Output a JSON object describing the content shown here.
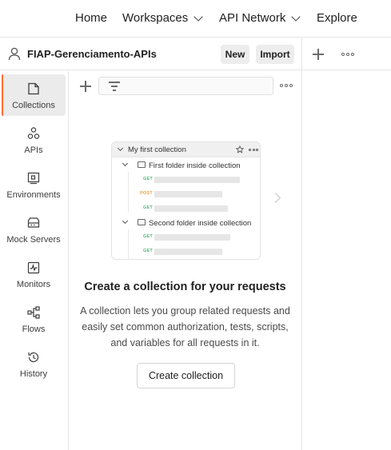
{
  "topnav": {
    "home": "Home",
    "workspaces": "Workspaces",
    "api_network": "API Network",
    "explore": "Explore"
  },
  "workspace": {
    "name": "FIAP-Gerenciamento-APIs",
    "new_label": "New",
    "import_label": "Import"
  },
  "sidebar": {
    "items": [
      {
        "label": "Collections",
        "icon": "collections-icon",
        "active": true
      },
      {
        "label": "APIs",
        "icon": "apis-icon"
      },
      {
        "label": "Environments",
        "icon": "environments-icon"
      },
      {
        "label": "Mock Servers",
        "icon": "mock-servers-icon"
      },
      {
        "label": "Monitors",
        "icon": "monitors-icon"
      },
      {
        "label": "Flows",
        "icon": "flows-icon"
      },
      {
        "label": "History",
        "icon": "history-icon"
      }
    ]
  },
  "illustration": {
    "collection_name": "My first collection",
    "folder1": "First folder inside collection",
    "folder2": "Second folder inside collection",
    "methods": [
      "GET",
      "POST",
      "GET",
      "GET",
      "GET"
    ],
    "method_colors": {
      "GET": "#55b07a",
      "POST": "#e8a34a"
    }
  },
  "empty_state": {
    "title": "Create a collection for your requests",
    "description": "A collection lets you group related requests and easily set common authorization, tests, scripts, and variables for all requests in it.",
    "button": "Create collection"
  },
  "colors": {
    "accent": "#ff6c37",
    "active_bg": "#ebebeb",
    "border": "#e6e6e6"
  }
}
